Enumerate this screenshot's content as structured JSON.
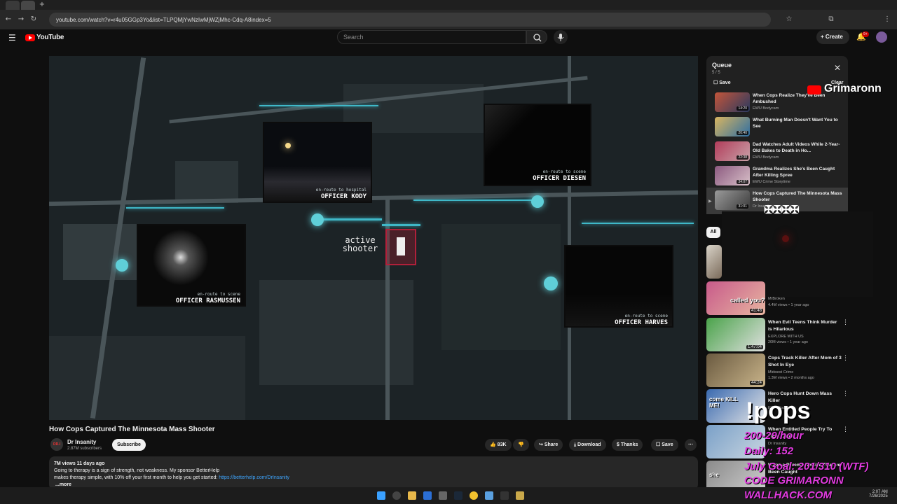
{
  "browser": {
    "url": "youtube.com/watch?v=r4u05GGp3Yo&list=TLPQMjYwNzIwMjWZjMhc-Cdq-A8index=5"
  },
  "header": {
    "logo": "YouTube",
    "search_placeholder": "Search",
    "create_label": "+ Create",
    "notif_count": "9+"
  },
  "video": {
    "title": "How Cops Captured The Minnesota Mass Shooter",
    "overlay": {
      "active_shooter": "active shooter",
      "cams": [
        {
          "sub": "en-route to hospital",
          "officer": "OFFICER KODY"
        },
        {
          "sub": "en-route to scene",
          "officer": "OFFICER DIESEN"
        },
        {
          "sub": "en-route to scene",
          "officer": "OFFICER RASMUSSEN"
        },
        {
          "sub": "en-route to scene",
          "officer": "OFFICER HARVES"
        }
      ]
    }
  },
  "channel": {
    "name": "Dr Insanity",
    "subs": "2.87M subscribers",
    "avatar_text": "DR.I",
    "subscribe": "Subscribe"
  },
  "actions": {
    "likes": "83K",
    "share": "Share",
    "download": "Download",
    "thanks": "Thanks",
    "save": "Save"
  },
  "description": {
    "stats": "7M views  11 days ago",
    "line1": "Going to therapy is a sign of strength, not weakness. My sponsor BetterHelp",
    "line2": "makes therapy simple, with 10% off your first month to help you get started: ",
    "link": "https://betterhelp.com/DrInsanity",
    "more": "...more"
  },
  "queue": {
    "title": "Queue",
    "count": "5 / 5",
    "save": "Save",
    "clear": "Clear",
    "items": [
      {
        "title": "When Cops Realize They've Been Ambushed",
        "channel": "EWU Bodycam",
        "duration": "14:20"
      },
      {
        "title": "What Burning Man Doesn't Want You to See",
        "channel": "",
        "duration": "20:40"
      },
      {
        "title": "Dad Watches Adult Videos While 2-Year-Old Bakes to Death in Ho...",
        "channel": "EWU Bodycam",
        "duration": "22:38"
      },
      {
        "title": "Grandma Realizes She's Been Caught After Killing Spree",
        "channel": "EWU Crime Storytime",
        "duration": "34:07"
      },
      {
        "title": "How Cops Captured The Minnesota Mass Shooter",
        "channel": "Dr Insanity",
        "duration": "31:01"
      }
    ]
  },
  "filters": {
    "all": "All"
  },
  "related": [
    {
      "title": "",
      "channel": "MrBroken",
      "meta": "4.4M views • 1 year ago",
      "duration": "41:48",
      "thumb_text": "called you?"
    },
    {
      "title": "When Evil Teens Think Murder is Hilarious",
      "channel": "EXPLORE WITH US",
      "meta": "20M views • 1 year ago",
      "duration": "1:47:04",
      "thumb_text": ""
    },
    {
      "title": "Cops Track Killer After Mom of 3 Shot In Eye",
      "channel": "Midwest Crime",
      "meta": "1.3M views • 2 months ago",
      "duration": "44:24",
      "thumb_text": ""
    },
    {
      "title": "Hero Cops Hunt Down Mass Killer",
      "channel": "EWU Bodycam",
      "meta": "",
      "duration": "",
      "thumb_text": "come KILL ME!"
    },
    {
      "title": "When Entitled People Try To Fight Cops",
      "channel": "Dr Insanity",
      "meta": "",
      "duration": "",
      "thumb_text": ""
    },
    {
      "title": "When a Parents Realize They've Been Caught",
      "channel": "",
      "meta": "",
      "duration": "",
      "thumb_text": "she"
    }
  ],
  "stream_overlay": {
    "brand": "Grimaronn",
    "pops": "!pops",
    "lines": [
      "200-29/hour",
      "Daily: 152",
      "July Goal: 201/310 (WTF)",
      "CODE GRIMARONN",
      "WALLHACK.COM"
    ]
  },
  "taskbar": {
    "time": "2:07 AM",
    "date": "7/26/2025"
  }
}
